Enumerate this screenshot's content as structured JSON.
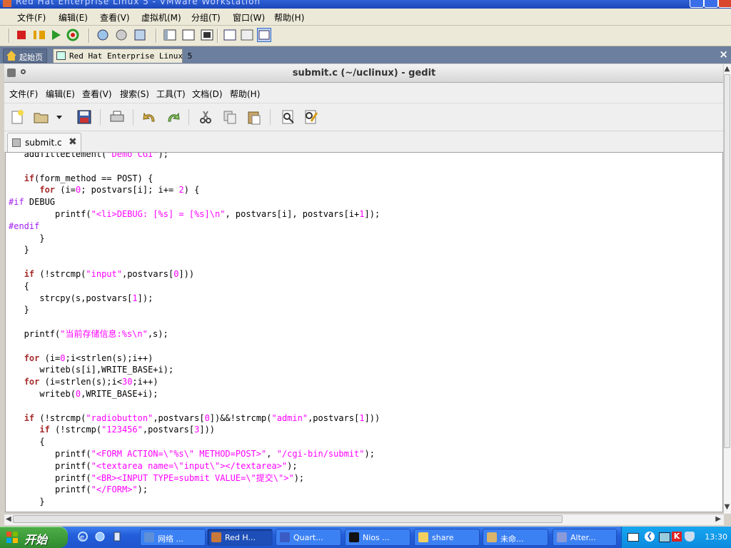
{
  "vmware": {
    "title": "Red Hat Enterprise Linux 5 - VMware Workstation",
    "menu": [
      "文件(F)",
      "编辑(E)",
      "查看(V)",
      "虚拟机(M)",
      "分组(T)",
      "窗口(W)",
      "帮助(H)"
    ],
    "tabs": [
      {
        "label": "起始页",
        "icon": "home-icon"
      },
      {
        "label": "Red Hat Enterprise Linux 5",
        "icon": "vm-icon"
      }
    ],
    "close_glyph": "×"
  },
  "gedit": {
    "title": "submit.c (~/uclinux) - gedit",
    "menu": [
      "文件(F)",
      "编辑(E)",
      "查看(V)",
      "搜索(S)",
      "工具(T)",
      "文档(D)",
      "帮助(H)"
    ],
    "tab_label": "submit.c",
    "tab_close_glyph": "✖"
  },
  "code_lines": [
    [
      {
        "t": "   addTitleElement("
      },
      {
        "c": "s",
        "t": "\"Demo CGI\""
      },
      {
        "t": ");"
      }
    ],
    [
      {
        "t": ""
      }
    ],
    [
      {
        "t": "   "
      },
      {
        "c": "k",
        "t": "if"
      },
      {
        "t": "(form_method == POST) {"
      }
    ],
    [
      {
        "t": "      "
      },
      {
        "c": "k",
        "t": "for"
      },
      {
        "t": " (i="
      },
      {
        "c": "n",
        "t": "0"
      },
      {
        "t": "; postvars[i]; i+= "
      },
      {
        "c": "n",
        "t": "2"
      },
      {
        "t": ") {"
      }
    ],
    [
      {
        "c": "p",
        "t": "#if"
      },
      {
        "t": " DEBUG"
      }
    ],
    [
      {
        "t": "         printf("
      },
      {
        "c": "s",
        "t": "\"<li>DEBUG: [%s] = [%s]\\n\""
      },
      {
        "t": ", postvars[i], postvars[i+"
      },
      {
        "c": "n",
        "t": "1"
      },
      {
        "t": "]);"
      }
    ],
    [
      {
        "c": "p",
        "t": "#endif"
      }
    ],
    [
      {
        "t": "      }"
      }
    ],
    [
      {
        "t": "   }"
      }
    ],
    [
      {
        "t": ""
      }
    ],
    [
      {
        "t": "   "
      },
      {
        "c": "k",
        "t": "if"
      },
      {
        "t": " (!strcmp("
      },
      {
        "c": "s",
        "t": "\"input\""
      },
      {
        "t": ",postvars["
      },
      {
        "c": "n",
        "t": "0"
      },
      {
        "t": "]))"
      }
    ],
    [
      {
        "t": "   {"
      }
    ],
    [
      {
        "t": "      strcpy(s,postvars["
      },
      {
        "c": "n",
        "t": "1"
      },
      {
        "t": "]);"
      }
    ],
    [
      {
        "t": "   }"
      }
    ],
    [
      {
        "t": ""
      }
    ],
    [
      {
        "t": "   printf("
      },
      {
        "c": "s",
        "t": "\"当前存储信息:%s\\n\""
      },
      {
        "t": ",s);"
      }
    ],
    [
      {
        "t": ""
      }
    ],
    [
      {
        "t": "   "
      },
      {
        "c": "k",
        "t": "for"
      },
      {
        "t": " (i="
      },
      {
        "c": "n",
        "t": "0"
      },
      {
        "t": ";i<strlen(s);i++)"
      }
    ],
    [
      {
        "t": "      writeb(s[i],WRITE_BASE+i);"
      }
    ],
    [
      {
        "t": "   "
      },
      {
        "c": "k",
        "t": "for"
      },
      {
        "t": " (i=strlen(s);i<"
      },
      {
        "c": "n",
        "t": "30"
      },
      {
        "t": ";i++)"
      }
    ],
    [
      {
        "t": "      writeb("
      },
      {
        "c": "n",
        "t": "0"
      },
      {
        "t": ",WRITE_BASE+i);"
      }
    ],
    [
      {
        "t": ""
      }
    ],
    [
      {
        "t": "   "
      },
      {
        "c": "k",
        "t": "if"
      },
      {
        "t": " (!strcmp("
      },
      {
        "c": "s",
        "t": "\"radiobutton\""
      },
      {
        "t": ",postvars["
      },
      {
        "c": "n",
        "t": "0"
      },
      {
        "t": "])&&!strcmp("
      },
      {
        "c": "s",
        "t": "\"admin\""
      },
      {
        "t": ",postvars["
      },
      {
        "c": "n",
        "t": "1"
      },
      {
        "t": "]))"
      }
    ],
    [
      {
        "t": "      "
      },
      {
        "c": "k",
        "t": "if"
      },
      {
        "t": " (!strcmp("
      },
      {
        "c": "s",
        "t": "\"123456\""
      },
      {
        "t": ",postvars["
      },
      {
        "c": "n",
        "t": "3"
      },
      {
        "t": "]))"
      }
    ],
    [
      {
        "t": "      {"
      }
    ],
    [
      {
        "t": "         printf("
      },
      {
        "c": "s",
        "t": "\"<FORM ACTION=\\\"%s\\\" METHOD=POST>\""
      },
      {
        "t": ", "
      },
      {
        "c": "s",
        "t": "\"/cgi-bin/submit\""
      },
      {
        "t": ");"
      }
    ],
    [
      {
        "t": "         printf("
      },
      {
        "c": "s",
        "t": "\"<textarea name=\\\"input\\\"></textarea>\""
      },
      {
        "t": ");"
      }
    ],
    [
      {
        "t": "         printf("
      },
      {
        "c": "s",
        "t": "\"<BR><INPUT TYPE=submit VALUE=\\\"提交\\\">\""
      },
      {
        "t": ");"
      }
    ],
    [
      {
        "t": "         printf("
      },
      {
        "c": "s",
        "t": "\"</FORM>\""
      },
      {
        "t": ");"
      }
    ],
    [
      {
        "t": "      }"
      }
    ]
  ],
  "taskbar": {
    "start_label": "开始",
    "tasks": [
      {
        "label": "网络 ...",
        "icon": "network-icon",
        "color": "#5e8fd8"
      },
      {
        "label": "Red H...",
        "icon": "vmware-icon",
        "color": "#c8783a",
        "active": true
      },
      {
        "label": "Quart...",
        "icon": "quartus-icon",
        "color": "#3b5bc4"
      },
      {
        "label": "Nios ...",
        "icon": "terminal-icon",
        "color": "#111111"
      },
      {
        "label": "share",
        "icon": "folder-icon",
        "color": "#f2d060"
      },
      {
        "label": "未命...",
        "icon": "paint-icon",
        "color": "#d9b46a"
      },
      {
        "label": "Alter...",
        "icon": "altera-icon",
        "color": "#8a9ad8"
      }
    ],
    "clock": "13:30"
  },
  "colors": {
    "keyword": "#a52a2a",
    "string": "#ff00ff",
    "preproc": "#a020f0",
    "taskbar": "#245edb"
  }
}
